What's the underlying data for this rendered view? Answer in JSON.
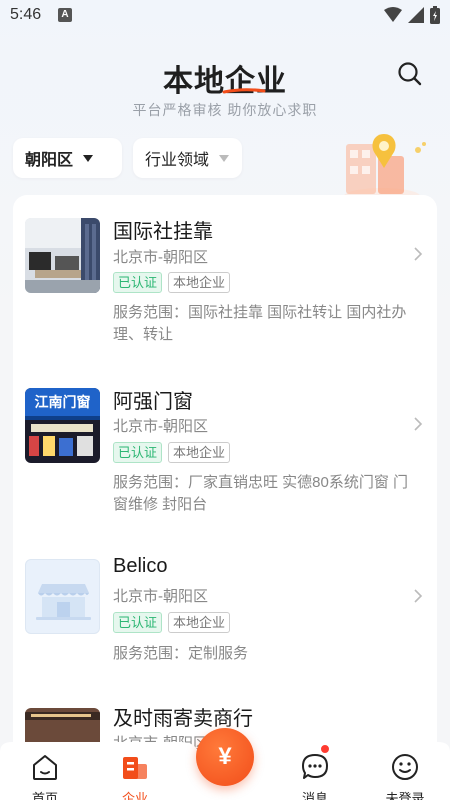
{
  "status_bar": {
    "time": "5:46",
    "notification_icon": "A"
  },
  "header": {
    "title": "本地企业",
    "subtitle": "平台严格审核 助你放心求职"
  },
  "filters": {
    "district": "朝阳区",
    "industry": "行业领域"
  },
  "companies": [
    {
      "name": "国际社挂靠",
      "location": "北京市-朝阳区",
      "verified_tag": "已认证",
      "local_tag": "本地企业",
      "scope_line1": "服务范围：国际社挂靠 国际社转让 国内社办",
      "scope_line2": "理、转让",
      "thumb_icon": "office-photo"
    },
    {
      "name": "阿强门窗",
      "location": "北京市-朝阳区",
      "verified_tag": "已认证",
      "local_tag": "本地企业",
      "scope_line1": "服务范围：厂家直销忠旺 实德80系统门窗 门",
      "scope_line2": "窗维修 封阳台",
      "thumb_sign": "江南门窗"
    },
    {
      "name": "Belico",
      "location": "北京市-朝阳区",
      "verified_tag": "已认证",
      "local_tag": "本地企业",
      "scope_line1": "服务范围：定制服务",
      "scope_line2": "",
      "thumb_icon": "shop-icon"
    },
    {
      "name": "及时雨寄卖商行",
      "location": "北京市-朝阳区"
    }
  ],
  "bottom_nav": {
    "home": "首页",
    "enterprise": "企业",
    "center": "¥",
    "messages": "消息",
    "profile": "未登录"
  },
  "colors": {
    "accent": "#f24d1a",
    "verified": "#2bb673"
  }
}
